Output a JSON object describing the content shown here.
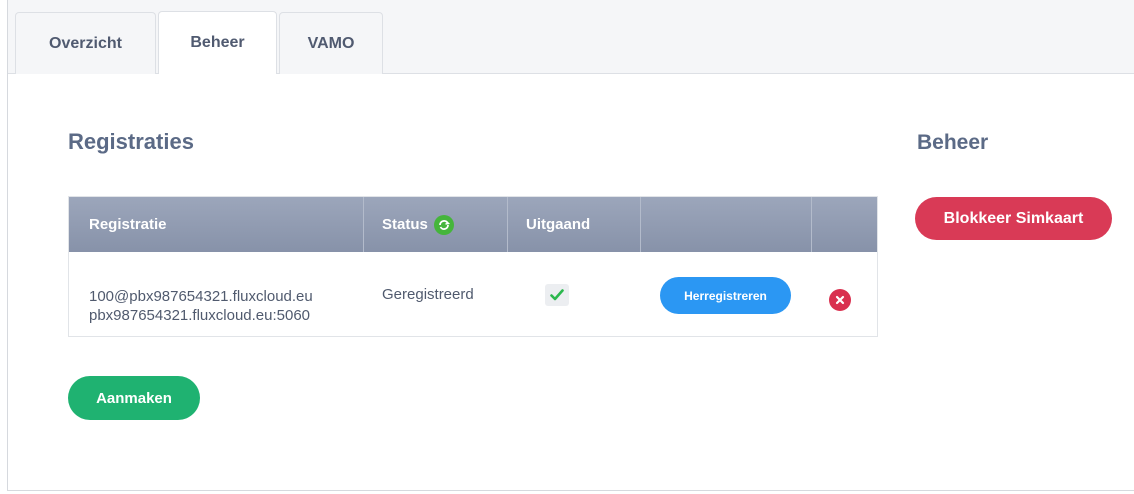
{
  "tabs": [
    {
      "label": "Overzicht",
      "active": false
    },
    {
      "label": "Beheer",
      "active": true
    },
    {
      "label": "VAMO",
      "active": false
    }
  ],
  "registraties": {
    "title": "Registraties",
    "columns": [
      "Registratie",
      "Status",
      "Uitgaand",
      "",
      ""
    ],
    "status_icon": "sync-icon",
    "rows": [
      {
        "registratie_line1": "100@pbx987654321.fluxcloud.eu",
        "registratie_line2": "pbx987654321.fluxcloud.eu:5060",
        "status": "Geregistreerd",
        "uitgaand": true,
        "action_label": "Herregistreren",
        "delete_icon": "close-circle-icon"
      }
    ],
    "create_label": "Aanmaken"
  },
  "beheer": {
    "title": "Beheer",
    "block_label": "Blokkeer Simkaart"
  },
  "colors": {
    "header_bg": "#8f9ab0",
    "primary_blue": "#2b97f3",
    "success_green": "#1fb271",
    "danger_red": "#d93a56",
    "status_green": "#45b53b"
  }
}
